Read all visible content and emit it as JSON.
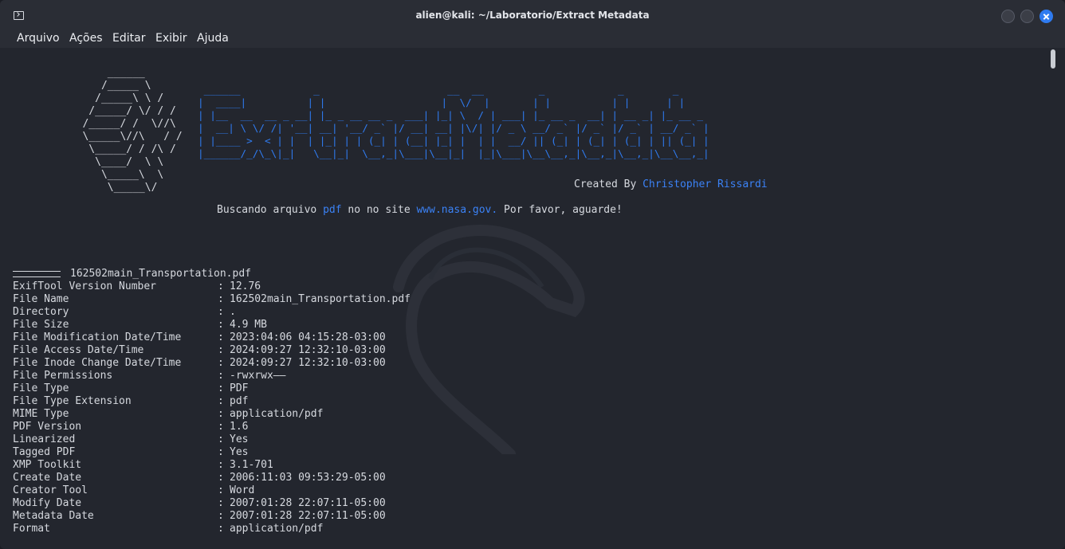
{
  "window": {
    "title": "alien@kali: ~/Laboratorio/Extract Metadata"
  },
  "menu": {
    "items": [
      "Arquivo",
      "Ações",
      "Editar",
      "Exibir",
      "Ajuda"
    ]
  },
  "banner": {
    "skull_ascii": "       ______\n      /_____ \\\n     /_____\\ \\ /\n    /_____/ \\/ / /\n   /_____/ /  \\//\\\n   \\_____\\//\\   / /\n    \\_____/ / /\\ /\n     \\____/  \\ \\\n      \\_____\\  \\\n       \\_____\\/",
    "title_ascii_line1": " ______            _                     __  __         _            _        _",
    "title_ascii_line2": "|  ____|          | |                   |  \\/  |       | |          | |      | |",
    "title_ascii_line3": "| |__  __  __ _ __| |_ _ __ __ _  ___| |_| \\  / | ___| |_ __ _  __| | __ _| |_ __ _",
    "title_ascii_line4": "|  __| \\ \\/ /| '__| __| '__/ _` |/ __| __| |\\/| |/ _ \\ __/ _` |/ _` |/ _` | __/ _` |",
    "title_ascii_line5": "| |____ >  < | |  | |_| | | (_| | (__| |_| |  | |  __/ || (_| | (_| | (_| | || (_| |",
    "title_ascii_line6": "|______/_/\\_\\|_|   \\__|_|  \\__,_|\\___|\\__|_|  |_|\\___|\\__\\__,_|\\__,_|\\__,_|\\__\\__,_|",
    "credit_prefix": "Created By ",
    "credit_author": "Christopher Rissardi"
  },
  "search": {
    "prefix": "Buscando arquivo ",
    "filetype": "pdf",
    "middle": " no no site ",
    "site": "www.nasa.gov.",
    "suffix": " Por favor, aguarde!"
  },
  "file_header": "162502main_Transportation.pdf",
  "metadata": [
    {
      "key": "ExifTool Version Number",
      "value": "12.76"
    },
    {
      "key": "File Name",
      "value": "162502main_Transportation.pdf"
    },
    {
      "key": "Directory",
      "value": "."
    },
    {
      "key": "File Size",
      "value": "4.9 MB"
    },
    {
      "key": "File Modification Date/Time",
      "value": "2023:04:06 04:15:28-03:00"
    },
    {
      "key": "File Access Date/Time",
      "value": "2024:09:27 12:32:10-03:00"
    },
    {
      "key": "File Inode Change Date/Time",
      "value": "2024:09:27 12:32:10-03:00"
    },
    {
      "key": "File Permissions",
      "value": "-rwxrwx——"
    },
    {
      "key": "File Type",
      "value": "PDF"
    },
    {
      "key": "File Type Extension",
      "value": "pdf"
    },
    {
      "key": "MIME Type",
      "value": "application/pdf"
    },
    {
      "key": "PDF Version",
      "value": "1.6"
    },
    {
      "key": "Linearized",
      "value": "Yes"
    },
    {
      "key": "Tagged PDF",
      "value": "Yes"
    },
    {
      "key": "XMP Toolkit",
      "value": "3.1-701"
    },
    {
      "key": "Create Date",
      "value": "2006:11:03 09:53:29-05:00"
    },
    {
      "key": "Creator Tool",
      "value": "Word"
    },
    {
      "key": "Modify Date",
      "value": "2007:01:28 22:07:11-05:00"
    },
    {
      "key": "Metadata Date",
      "value": "2007:01:28 22:07:11-05:00"
    },
    {
      "key": "Format",
      "value": "application/pdf"
    }
  ],
  "metadata_separator": ":",
  "colors": {
    "accent": "#2f7bf0",
    "text": "#d6d9df",
    "background": "#23262e"
  }
}
